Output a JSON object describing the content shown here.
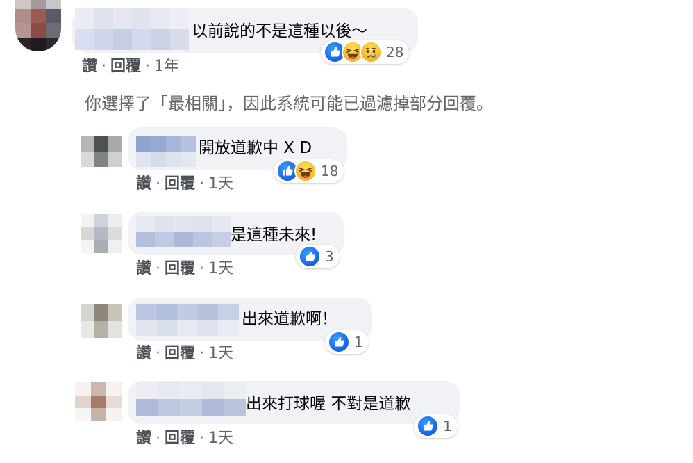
{
  "notice": "你選擇了「最相關」，因此系統可能已過濾掉部分回覆。",
  "comments": [
    {
      "text": "以前說的不是這種以後～",
      "reactions": [
        "like-icon",
        "haha-icon",
        "sad-icon"
      ],
      "reaction_count": "28",
      "like_label": "讚",
      "reply_label": "回覆",
      "time": "1年"
    },
    {
      "text": "開放道歉中 X D",
      "reactions": [
        "like-icon",
        "haha-icon"
      ],
      "reaction_count": "18",
      "like_label": "讚",
      "reply_label": "回覆",
      "time": "1天"
    },
    {
      "text": "是這種未來!",
      "reactions": [
        "like-icon"
      ],
      "reaction_count": "3",
      "like_label": "讚",
      "reply_label": "回覆",
      "time": "1天"
    },
    {
      "text": "出來道歉啊！",
      "reactions": [
        "like-icon"
      ],
      "reaction_count": "1",
      "like_label": "讚",
      "reply_label": "回覆",
      "time": "1天"
    },
    {
      "text": "出來打球喔 不對是道歉",
      "reactions": [
        "like-icon"
      ],
      "reaction_count": "1",
      "like_label": "讚",
      "reply_label": "回覆",
      "time": "1天"
    }
  ],
  "colors": {
    "bubble": "#f0f2f5",
    "meta": "#65676b",
    "like_blue": "#1877f2",
    "emoji_yellow": "#f7b125"
  }
}
